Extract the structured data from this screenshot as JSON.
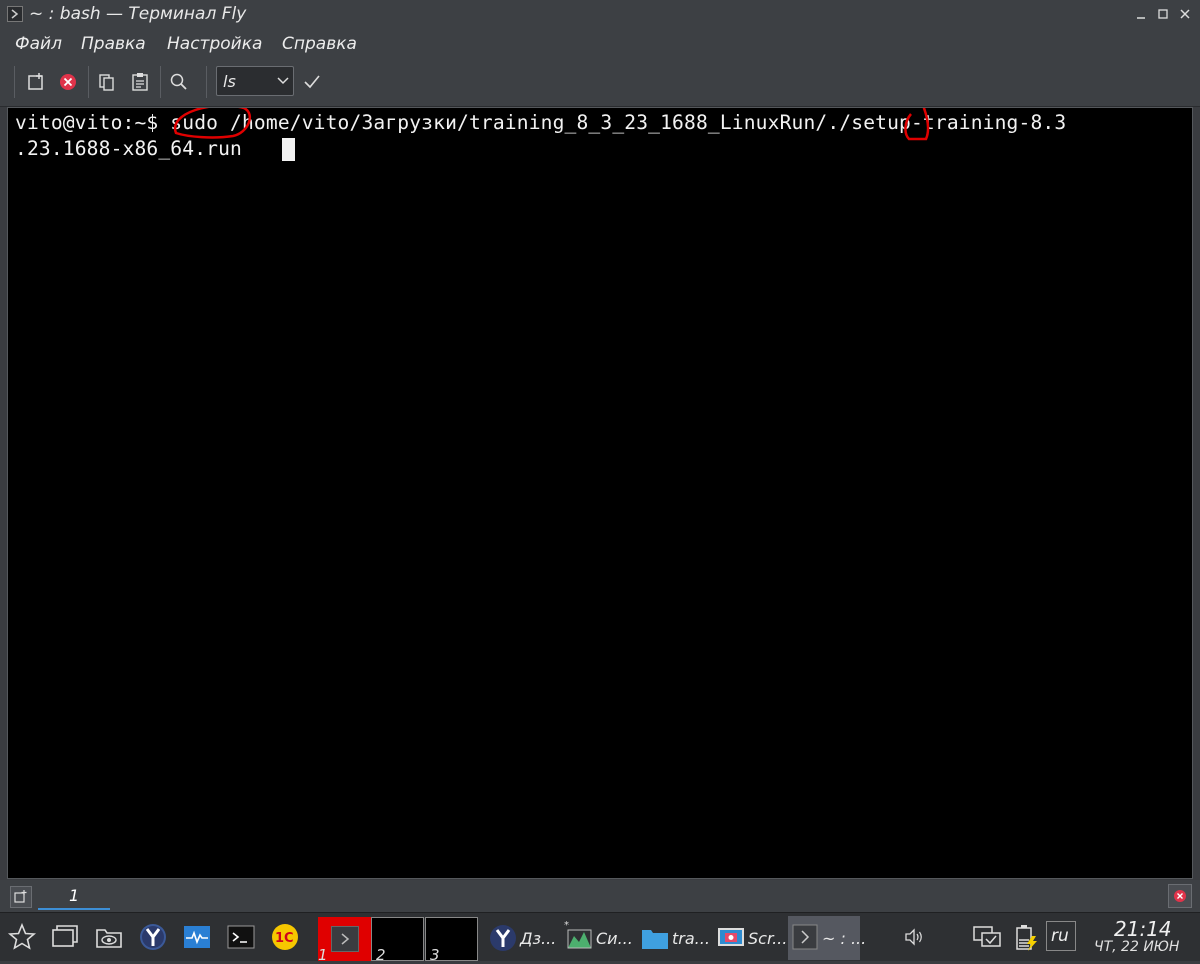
{
  "window": {
    "title": "~ : bash — Терминал Fly"
  },
  "menu": [
    "Файл",
    "Правка",
    "Настройка",
    "Справка"
  ],
  "toolbar": {
    "command_value": "ls"
  },
  "terminal": {
    "line1": "vito@vito:~$ sudo /home/vito/Загрузки/training_8_3_23_1688_LinuxRun/./setup-training-8.3",
    "line2": ".23.1688-x86_64.run ",
    "annotation_color": "#e00000"
  },
  "tabs": [
    "1"
  ],
  "taskbar": {
    "desktops": [
      "1",
      "2",
      "3"
    ],
    "tasks": [
      {
        "label": "Дз..."
      },
      {
        "label": "Си..."
      },
      {
        "label": "tra..."
      },
      {
        "label": "Scr..."
      },
      {
        "label": "~ : ..."
      }
    ],
    "language": "ru",
    "time": "21:14",
    "date": "ЧТ, 22 ИЮН"
  },
  "colors": {
    "accent": "#3d8fd6",
    "close_red": "#e0334a",
    "desktop_active": "#e00000"
  }
}
